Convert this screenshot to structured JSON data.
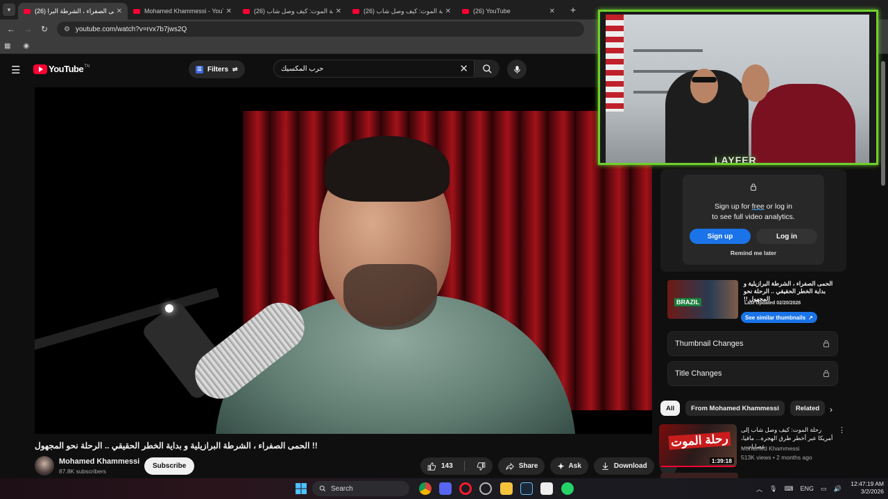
{
  "browser": {
    "tabs": [
      {
        "title": "(26) الحمى الصفراء ، الشرطة البرا",
        "active": true
      },
      {
        "title": "Mohamed Khammessi - YouTube",
        "active": false
      },
      {
        "title": "(26) رحلة الموت: كيف وصل شاب",
        "active": false
      },
      {
        "title": "(26) رحلة الموت: كيف وصل شاب",
        "active": false
      },
      {
        "title": "(26) YouTube",
        "active": false
      }
    ],
    "url": "youtube.com/watch?v=rvx7b7jws2Q"
  },
  "youtube": {
    "logo_text": "YouTube",
    "logo_country": "TN",
    "filters_label": "Filters",
    "search_value": "حرب المكسيك"
  },
  "video": {
    "title": "!! الحمى الصفراء ، الشرطة البرازيلية و بداية الخطر الحقيقي .. الرحلة نحو المجهول",
    "channel": "Mohamed Khammessi",
    "subscribers": "87.8K subscribers",
    "subscribe_label": "Subscribe",
    "likes": "143",
    "share_label": "Share",
    "ask_label": "Ask",
    "download_label": "Download"
  },
  "overlay": {
    "brand": "LAYFER",
    "accent": "#6fcf2e"
  },
  "analytics_popup": {
    "line1_pre": "Sign up for ",
    "line1_free": "free",
    "line1_post": " or log in",
    "line2": "to see full video analytics.",
    "signup_label": "Sign up",
    "login_label": "Log in",
    "remind_label": "Remind me later"
  },
  "thumbnail_card": {
    "title": "الحمى الصفراء ، الشرطة البرازيلية و بداية الخطر الحقيقي .. الرحلة نحو المجهول !!",
    "thumb_text": "BRAZIL",
    "last_updated": "Last Updated 02/20/2026",
    "similar_label": "See similar thumbnails"
  },
  "panels": {
    "thumbnail_changes": "Thumbnail Changes",
    "title_changes": "Title Changes"
  },
  "chips": [
    "All",
    "From Mohamed Khammessi",
    "Related"
  ],
  "recommended": [
    {
      "title": "رحلة الموت: كيف وصل شاب إلى أمريكا عبر أخطر طرق الهجرة... مافيا، عصابات...",
      "thumb_text": "رحلة الموت",
      "duration": "1:39:18",
      "channel": "Mohamed Khammessi",
      "views": "513K views",
      "age": "2 months ago"
    }
  ],
  "taskbar": {
    "search_label": "Search",
    "language": "ENG",
    "time": "12:47:19 AM",
    "date": "3/2/2026"
  },
  "colors": {
    "youtube_red": "#ff0033",
    "link_blue": "#1a73e8",
    "background": "#0f0f0f"
  }
}
